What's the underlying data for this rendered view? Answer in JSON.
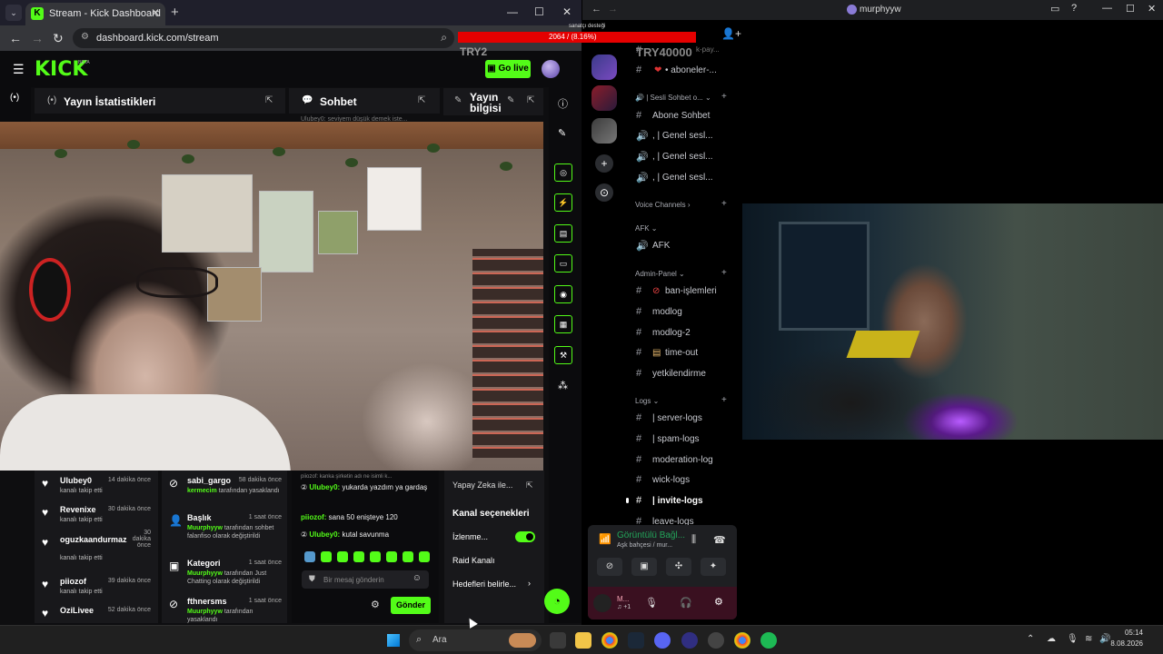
{
  "browser": {
    "tab_title": "Stream - Kick Dashboard",
    "url": "dashboard.kick.com/stream",
    "new_tab": "+",
    "tab_close": "✕"
  },
  "kick": {
    "logo": "KICK",
    "beta": "BETA",
    "go_live": "Go live",
    "panels": {
      "stats_title": "Yayın İstatistikleri",
      "chat_title": "Sohbet",
      "info_title_1": "Yayın",
      "info_title_2": "bilgisi"
    },
    "chat_preview": "Ulubey0: seviyem düşük demek iste...",
    "feed_left": [
      {
        "name": "Ulubey0",
        "time": "14 dakika önce",
        "desc": "kanalı takip etti"
      },
      {
        "name": "Revenixe",
        "time": "30 dakika önce",
        "desc": "kanalı takip etti"
      },
      {
        "name": "oguzkaandurmaz",
        "time": "30 dakika önce",
        "desc": "kanalı takip etti"
      },
      {
        "name": "piiozof",
        "time": "39 dakika önce",
        "desc": "kanalı takip etti"
      },
      {
        "name": "OziLivee",
        "time": "52 dakika önce",
        "desc": ""
      }
    ],
    "feed_mod": [
      {
        "name": "sabi_gargo",
        "time": "58 dakika önce",
        "actor": "kermecim",
        "desc": "tarafından yasaklandı"
      },
      {
        "name": "Başlık",
        "time": "1 saat önce",
        "actor": "Muurphyyw",
        "desc": "tarafından sohbet falanfiso olarak değiştirildi"
      },
      {
        "name": "Kategori",
        "time": "1 saat önce",
        "actor": "Muurphyyw",
        "desc": "tarafından Just Chatting olarak değiştirildi"
      },
      {
        "name": "fthnersms",
        "time": "1 saat önce",
        "actor": "Muurphyyw",
        "desc": "tarafından yasaklandı"
      }
    ],
    "chat": {
      "reply_hint": "piiozof: kanka şirketin adı ne isimli k...",
      "messages": [
        {
          "user": "Ulubey0:",
          "text": "yukarda yazdım ya gardaş"
        },
        {
          "user": "piiozof:",
          "text": "sana 50 enişteye 120"
        },
        {
          "user": "Ulubey0:",
          "text": "kutal savunma"
        }
      ],
      "placeholder": "Bir mesaj gönderin",
      "send": "Gönder"
    },
    "options": {
      "ai": "Yapay Zeka ile...",
      "title": "Kanal seçenekleri",
      "watch": "İzlenme...",
      "raid": "Raid Kanalı",
      "goals": "Hedefleri belirle..."
    }
  },
  "overlay": {
    "sender": "sanatçı desteği",
    "progress": "2064 / (8.16%)",
    "progress_fraction": 0.0816,
    "try2": "TRY2",
    "try40000": "TRY40000"
  },
  "discord": {
    "window_title": "murphyyw",
    "channels_top": [
      {
        "name": "k-pay..."
      },
      {
        "name": "• aboneler-..."
      }
    ],
    "cat_voice_sesli": "| Sesli Sohbet o...",
    "voice_ch": [
      {
        "name": "Abone Sohbet"
      },
      {
        "name": ", | Genel sesl..."
      },
      {
        "name": ", | Genel sesl..."
      },
      {
        "name": ", | Genel sesl..."
      }
    ],
    "cat_voice_channels": "Voice Channels",
    "cat_afk": "AFK",
    "afk": "AFK",
    "cat_admin": "Admin-Panel",
    "admin": [
      "ban-işlemleri",
      "modlog",
      "modlog-2",
      "time-out",
      "yetkilendirme"
    ],
    "cat_logs": "Logs",
    "logs": [
      "| server-logs",
      "| spam-logs",
      "moderation-log",
      "wick-logs",
      "| invite-logs",
      "leave-logs"
    ],
    "voice_status": "Görüntülü Bağl...",
    "voice_sub": "Aşk bahçesi / mur...",
    "user_short": "M...",
    "user_status": "♫ +1"
  },
  "taskbar": {
    "search": "Ara",
    "time": "05:14",
    "date": "8.08.2026"
  },
  "colors": {
    "kick_green": "#53fc18",
    "discord_green": "#23a55a",
    "overlay_red": "#e50000"
  }
}
